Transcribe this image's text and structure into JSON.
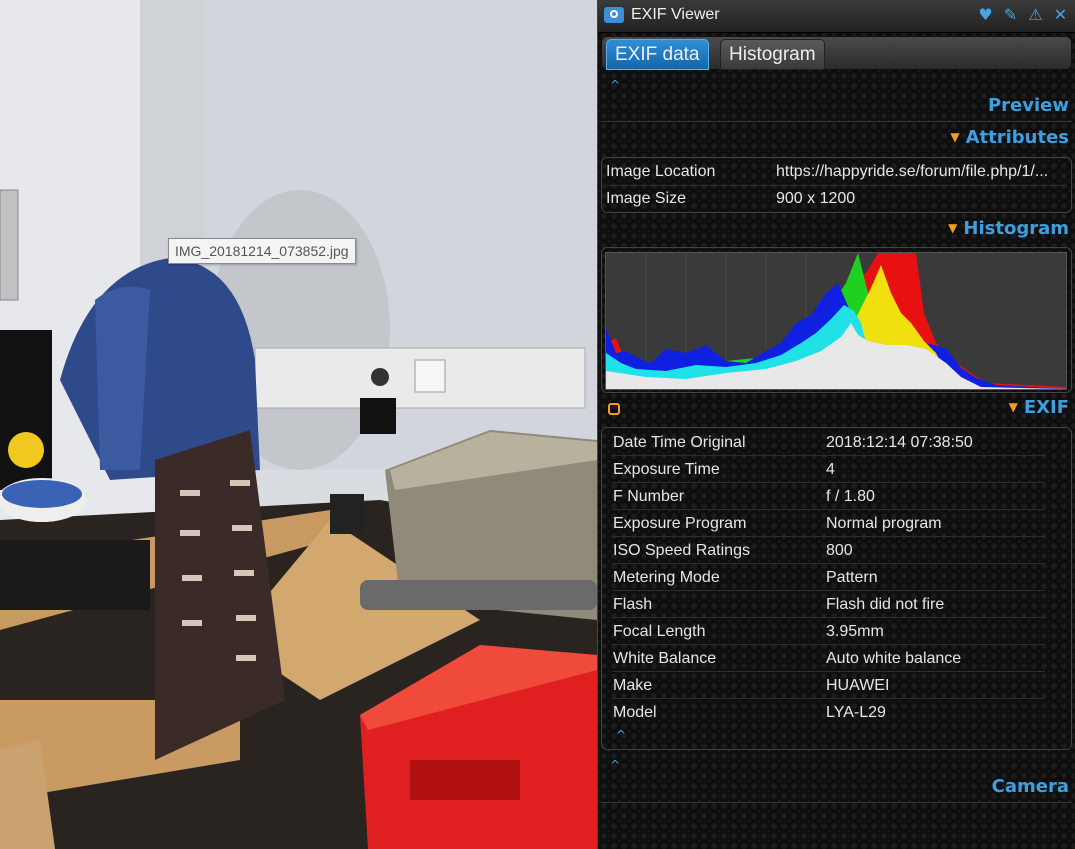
{
  "photo": {
    "tooltip": "IMG_20181214_073852.jpg"
  },
  "window": {
    "title": "EXIF Viewer",
    "icons": [
      "heart-icon",
      "wrench-icon",
      "warning-icon",
      "close-icon"
    ]
  },
  "tabs": [
    {
      "label": "EXIF data",
      "active": true
    },
    {
      "label": "Histogram",
      "active": false
    }
  ],
  "sections": {
    "preview": "Preview",
    "attributes": "Attributes",
    "histogram": "Histogram",
    "exif": "EXIF",
    "camera": "Camera"
  },
  "attributes": [
    {
      "label": "Image Location",
      "value": "https://happyride.se/forum/file.php/1/..."
    },
    {
      "label": "Image Size",
      "value": "900 x 1200"
    }
  ],
  "exif": [
    {
      "label": "Date Time Original",
      "value": "2018:12:14 07:38:50"
    },
    {
      "label": "Exposure Time",
      "value": "4"
    },
    {
      "label": "F Number",
      "value": "f / 1.80"
    },
    {
      "label": "Exposure Program",
      "value": "Normal program"
    },
    {
      "label": "ISO Speed Ratings",
      "value": "800"
    },
    {
      "label": "Metering Mode",
      "value": "Pattern"
    },
    {
      "label": "Flash",
      "value": "Flash did not fire"
    },
    {
      "label": "Focal Length",
      "value": "3.95mm"
    },
    {
      "label": "White Balance",
      "value": "Auto white balance"
    },
    {
      "label": "Make",
      "value": "HUAWEI"
    },
    {
      "label": "Model",
      "value": "LYA-L29"
    }
  ],
  "colors": {
    "accent": "#3d9ee0",
    "toggle": "#f0a020",
    "histogram_bg": "#3a3a3a"
  }
}
